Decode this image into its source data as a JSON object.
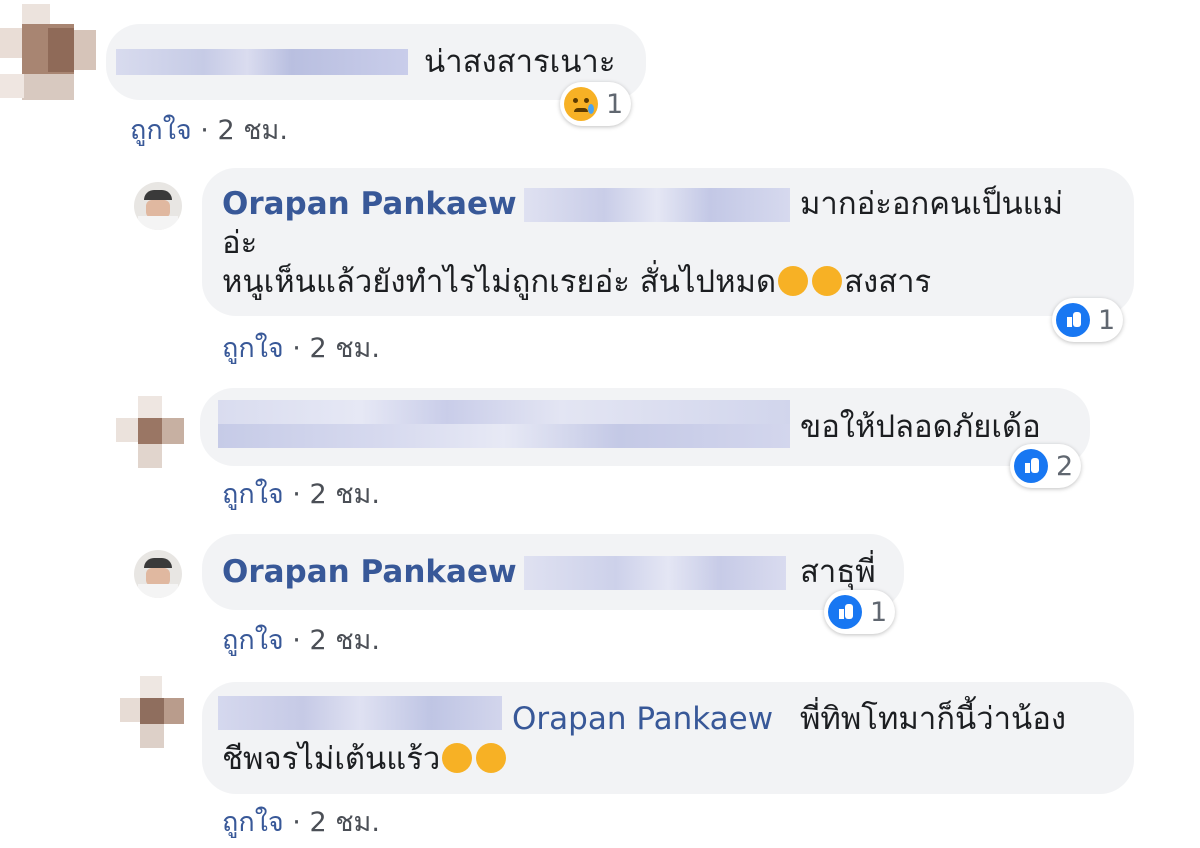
{
  "comments": [
    {
      "text": "น่าสงสารเนาะ",
      "meta_like": "ถูกใจ",
      "meta_sep": " · ",
      "meta_time": "2 ชม.",
      "reaction": {
        "type": "sad",
        "count": "1"
      }
    },
    {
      "author": "Orapan Pankaew",
      "line1": "มากอ่ะอกคนเป็นแม่",
      "line2": "อ่ะ",
      "line3": "หนูเห็นแล้วยังทำไรไม่ถูกเรยอ่ะ สั่นไปหมด",
      "line3_tail": "สงสาร",
      "meta_like": "ถูกใจ",
      "meta_sep": " · ",
      "meta_time": "2 ชม.",
      "reaction": {
        "type": "like",
        "count": "1"
      }
    },
    {
      "text": "ขอให้ปลอดภัยเด้อ",
      "meta_like": "ถูกใจ",
      "meta_sep": " · ",
      "meta_time": "2 ชม.",
      "reaction": {
        "type": "like",
        "count": "2"
      }
    },
    {
      "author": "Orapan Pankaew",
      "text": "สาธุพี่",
      "meta_like": "ถูกใจ",
      "meta_sep": " · ",
      "meta_time": "2 ชม.",
      "reaction": {
        "type": "like",
        "count": "1"
      }
    },
    {
      "mention": "Orapan Pankaew",
      "line1": "พี่ทิพโทมาก็นี้ว่าน้อง",
      "line2": "ชีพจรไม่เต้นแร้ว",
      "meta_like": "ถูกใจ",
      "meta_sep": " · ",
      "meta_time": "2 ชม."
    }
  ],
  "colors": {
    "link": "#385898",
    "bubble": "#f2f3f5",
    "like_blue": "#1877f2",
    "emoji_yellow": "#f7b125"
  }
}
